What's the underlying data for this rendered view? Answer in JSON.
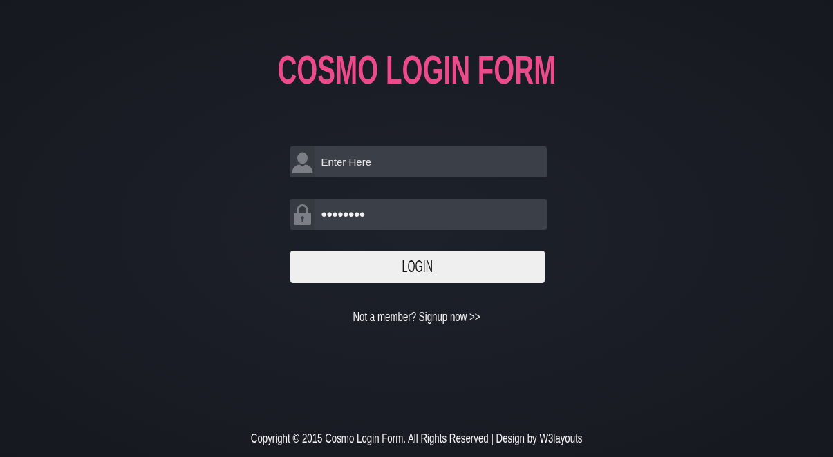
{
  "title": "COSMO LOGIN FORM",
  "form": {
    "fields": [
      {
        "kind": "username",
        "placeholder": "Enter Here"
      },
      {
        "kind": "password",
        "value": "••••••••"
      }
    ],
    "login_button": "LOGIN"
  },
  "signup": {
    "prompt": "Not a member?",
    "link": "Signup now >>"
  },
  "footer": {
    "text": "Copyright © 2015 Cosmo Login Form. All Rights Reserved | Design by",
    "link": "W3layouts"
  }
}
